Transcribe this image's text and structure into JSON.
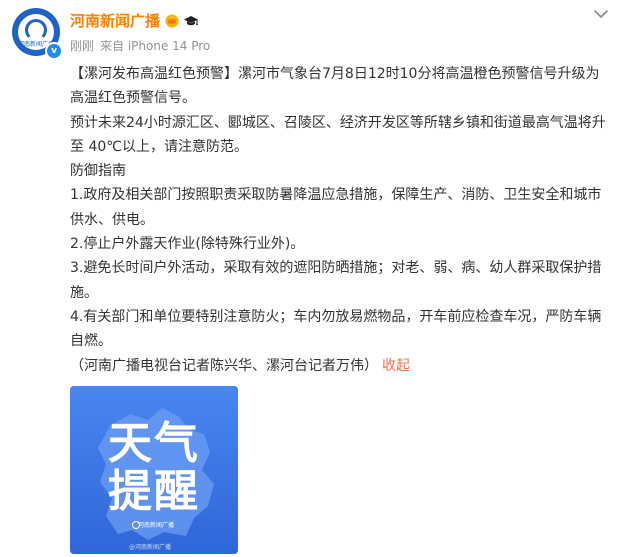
{
  "author": {
    "name": "河南新闻广播",
    "avatar_text": "河南新闻广播",
    "verified_mark": "v",
    "badges": [
      "crown-icon",
      "graduation-cap-icon"
    ]
  },
  "meta": {
    "time": "刚刚",
    "source": "来自 iPhone 14 Pro"
  },
  "post": {
    "paragraphs": [
      "【漯河发布高温红色预警】漯河市气象台7月8日12时10分将高温橙色预警信号升级为高温红色预警信号。",
      "预计未来24小时源汇区、郾城区、召陵区、经济开发区等所辖乡镇和街道最高气温将升至 40℃以上，请注意防范。",
      "防御指南",
      "1.政府及相关部门按照职责采取防暑降温应急措施，保障生产、消防、卫生安全和城市供水、供电。",
      "2.停止户外露天作业(除特殊行业外)。",
      "3.避免长时间户外活动，采取有效的遮阳防晒措施；对老、弱、病、幼人群采取保护措施。",
      "4.有关部门和单位要特别注意防火；车内勿放易燃物品，开车前应检查车况，严防车辆自燃。"
    ],
    "credit": "（河南广播电视台记者陈兴华、漯河台记者万伟）",
    "collapse_label": "收起"
  },
  "image": {
    "title_line1": "天气",
    "title_line2": "提醒",
    "logo_text": "河南新闻广播",
    "watermark": "@河南新闻广播"
  },
  "colors": {
    "name": "#ff8200",
    "meta": "#939393",
    "text": "#333333",
    "collapse": "#eb7350",
    "image_bg": "#3e78e8"
  }
}
